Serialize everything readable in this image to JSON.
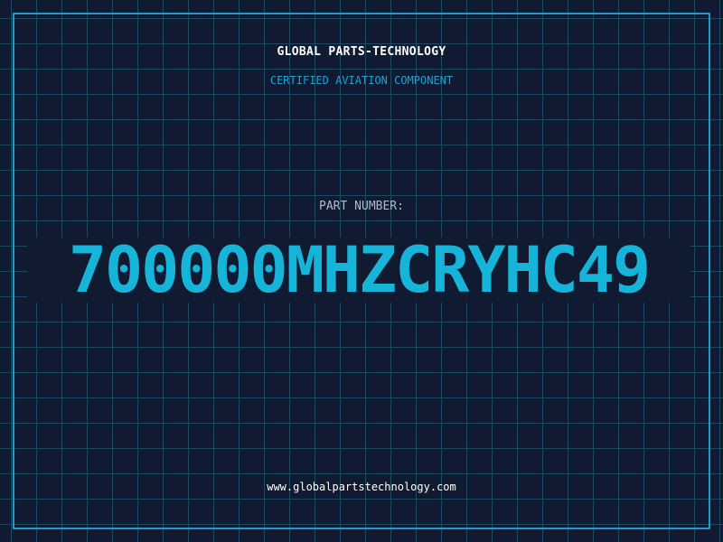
{
  "header": {
    "company": "GLOBAL PARTS-TECHNOLOGY",
    "tagline": "CERTIFIED AVIATION COMPONENT"
  },
  "part": {
    "label": "PART NUMBER:",
    "number": "700000MHZCRYHC49"
  },
  "footer": {
    "website": "www.globalpartstechnology.com"
  },
  "colors": {
    "background": "#101a30",
    "grid": "#1d4a62",
    "frame": "#1f9ac4",
    "accent": "#16b4d8"
  }
}
